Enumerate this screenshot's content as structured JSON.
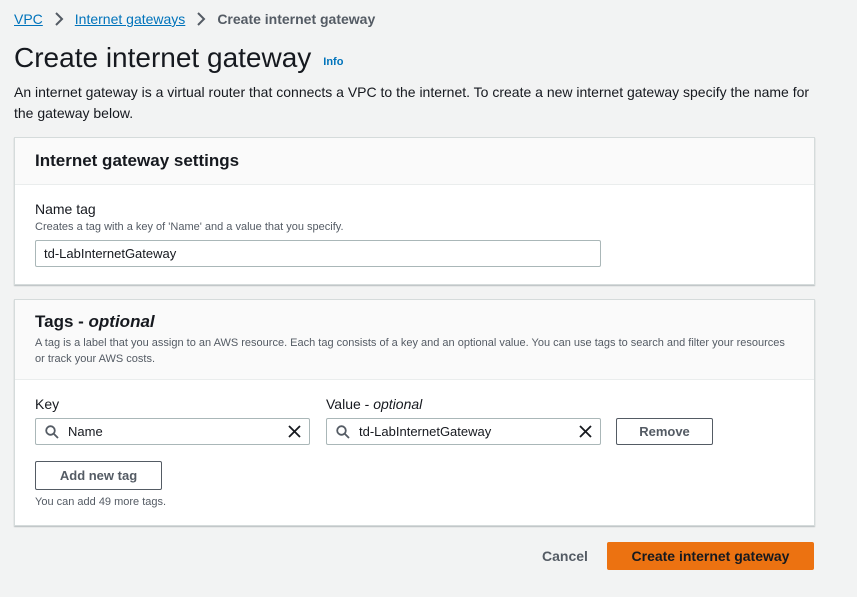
{
  "breadcrumb": {
    "items": [
      "VPC",
      "Internet gateways"
    ],
    "current": "Create internet gateway"
  },
  "page": {
    "title": "Create internet gateway",
    "info_label": "Info",
    "description": "An internet gateway is a virtual router that connects a VPC to the internet. To create a new internet gateway specify the name for the gateway below."
  },
  "settings": {
    "title": "Internet gateway settings",
    "name_tag_label": "Name tag",
    "name_tag_description": "Creates a tag with a key of 'Name' and a value that you specify.",
    "name_tag_value": "td-LabInternetGateway"
  },
  "tags": {
    "title": "Tags - ",
    "title_optional": "optional",
    "description": "A tag is a label that you assign to an AWS resource. Each tag consists of a key and an optional value. You can use tags to search and filter your resources or track your AWS costs.",
    "key_label": "Key",
    "value_label": "Value - ",
    "value_label_optional": "optional",
    "rows": [
      {
        "key": "Name",
        "value": "td-LabInternetGateway"
      }
    ],
    "remove_label": "Remove",
    "add_label": "Add new tag",
    "limit_text": "You can add 49 more tags."
  },
  "actions": {
    "cancel_label": "Cancel",
    "create_label": "Create internet gateway"
  },
  "colors": {
    "link": "#0073bb",
    "primary_button": "#ec7211",
    "background": "#f2f3f3"
  },
  "icons": [
    "chevron-right-icon",
    "search-icon",
    "clear-icon"
  ]
}
